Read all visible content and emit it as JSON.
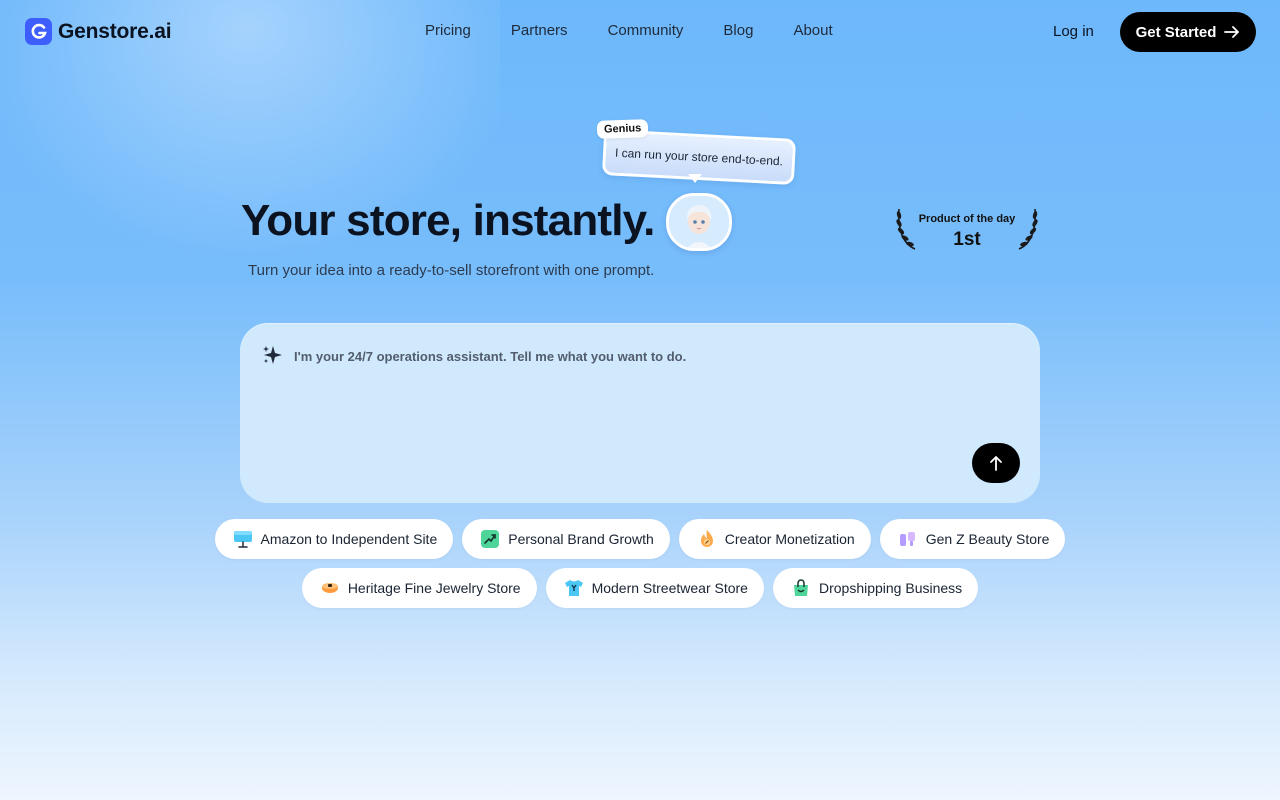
{
  "brand": {
    "name": "Genstore.ai",
    "accent": "#3d5dfc"
  },
  "nav": {
    "items": [
      "Pricing",
      "Partners",
      "Community",
      "Blog",
      "About"
    ]
  },
  "header": {
    "login_label": "Log in",
    "cta_label": "Get Started"
  },
  "hero": {
    "title": "Your store, instantly.",
    "subtitle": "Turn your idea into a ready-to-sell storefront with one prompt.",
    "assistant_tag": "Genius",
    "assistant_message": "I can run your store end-to-end."
  },
  "award": {
    "label": "Product of the day",
    "rank": "1st"
  },
  "prompt": {
    "placeholder": "I'm your 24/7 operations assistant. Tell me what you want to do."
  },
  "chips": {
    "row1": [
      {
        "label": "Amazon to Independent Site",
        "icon": "storefront-icon"
      },
      {
        "label": "Personal Brand Growth",
        "icon": "growth-chart-icon"
      },
      {
        "label": "Creator Monetization",
        "icon": "flame-coin-icon"
      },
      {
        "label": "Gen Z Beauty Store",
        "icon": "cosmetics-icon"
      }
    ],
    "row2": [
      {
        "label": "Heritage Fine Jewelry Store",
        "icon": "jewelry-icon"
      },
      {
        "label": "Modern Streetwear Store",
        "icon": "tshirt-icon"
      },
      {
        "label": "Dropshipping Business",
        "icon": "shopping-bag-icon"
      }
    ]
  }
}
